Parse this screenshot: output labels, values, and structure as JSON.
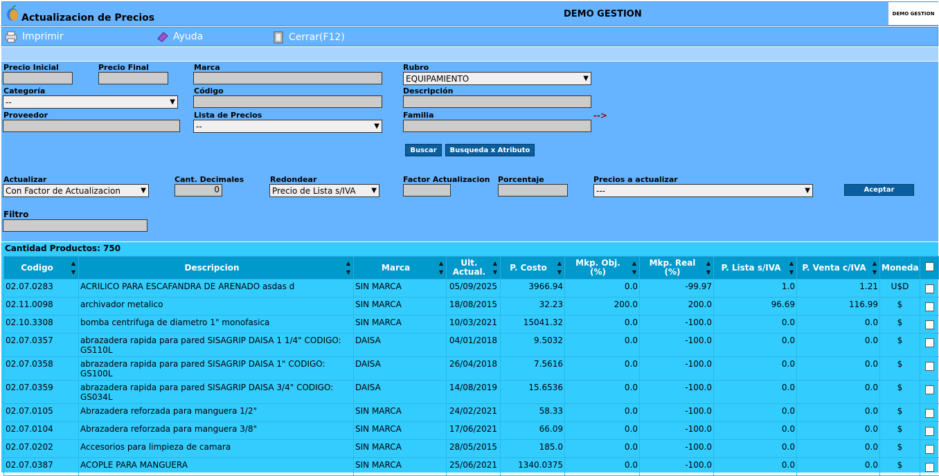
{
  "header": {
    "title": "Actualizacion de Precios",
    "company": "DEMO GESTION",
    "logo_text": "DEMO GESTION"
  },
  "toolbar": {
    "print": "Imprimir",
    "help": "Ayuda",
    "close": "Cerrar(F12)"
  },
  "filters": {
    "precio_inicial_label": "Precio Inicial",
    "precio_inicial": "",
    "precio_final_label": "Precio Final",
    "precio_final": "",
    "marca_label": "Marca",
    "marca": "",
    "rubro_label": "Rubro",
    "rubro": "EQUIPAMIENTO",
    "categoria_label": "Categoría",
    "categoria": "--",
    "codigo_label": "Código",
    "codigo": "",
    "descripcion_label": "Descripción",
    "descripcion": "",
    "proveedor_label": "Proveedor",
    "proveedor": "",
    "lista_label": "Lista de Precios",
    "lista": "--",
    "familia_label": "Familia",
    "familia": "",
    "familia_arrow": "-->",
    "buscar": "Buscar",
    "busqueda_atributo": "Busqueda x Atributo"
  },
  "update": {
    "actualizar_label": "Actualizar",
    "actualizar": "Con Factor de Actualizacion",
    "decimales_label": "Cant. Decimales",
    "decimales": "0",
    "redondear_label": "Redondear",
    "redondear": "Precio de Lista s/IVA",
    "factor_label": "Factor Actualizacion",
    "factor": "",
    "porcentaje_label": "Porcentaje",
    "porcentaje": "",
    "precios_label": "Precios a actualizar",
    "precios": "---",
    "aceptar": "Aceptar",
    "filtro_label": "Filtro",
    "filtro": ""
  },
  "table": {
    "count_label": "Cantidad Productos: 750",
    "columns": [
      "Codigo",
      "Descripcion",
      "Marca",
      "Ult. Actual.",
      "P. Costo",
      "Mkp. Obj. (%)",
      "Mkp. Real (%)",
      "P. Lista s/IVA",
      "P. Venta c/IVA",
      "Moneda"
    ],
    "rows": [
      [
        "02.07.0283",
        "ACRILICO PARA ESCAFANDRA DE ARENADO asdas d",
        "SIN MARCA",
        "05/09/2025",
        "3966.94",
        "0.0",
        "-99.97",
        "1.0",
        "1.21",
        "U$D"
      ],
      [
        "02.11.0098",
        "archivador metalico",
        "SIN MARCA",
        "18/08/2015",
        "32.23",
        "200.0",
        "200.0",
        "96.69",
        "116.99",
        "$"
      ],
      [
        "02.10.3308",
        "bomba centrifuga de diametro 1\" monofasica",
        "SIN MARCA",
        "10/03/2021",
        "15041.32",
        "0.0",
        "-100.0",
        "0.0",
        "0.0",
        "$"
      ],
      [
        "02.07.0357",
        "abrazadera rapida para pared SISAGRIP DAISA 1 1/4\" CODIGO: GS110L",
        "DAISA",
        "04/01/2018",
        "9.5032",
        "0.0",
        "-100.0",
        "0.0",
        "0.0",
        "$"
      ],
      [
        "02.07.0358",
        "abrazadera rapida para pared SISAGRIP DAISA 1\" CODIGO: GS100L",
        "DAISA",
        "26/04/2018",
        "7.5616",
        "0.0",
        "-100.0",
        "0.0",
        "0.0",
        "$"
      ],
      [
        "02.07.0359",
        "abrazadera rapida para pared SISAGRIP DAISA 3/4\" CODIGO: GS034L",
        "DAISA",
        "14/08/2019",
        "15.6536",
        "0.0",
        "-100.0",
        "0.0",
        "0.0",
        "$"
      ],
      [
        "02.07.0105",
        "Abrazadera reforzada para manguera 1/2\"",
        "SIN MARCA",
        "24/02/2021",
        "58.33",
        "0.0",
        "-100.0",
        "0.0",
        "0.0",
        "$"
      ],
      [
        "02.07.0104",
        "Abrazadera reforzada para manguera 3/8\"",
        "SIN MARCA",
        "17/06/2021",
        "66.09",
        "0.0",
        "-100.0",
        "0.0",
        "0.0",
        "$"
      ],
      [
        "02.07.0202",
        "Accesorios para limpieza de camara",
        "SIN MARCA",
        "28/05/2015",
        "185.0",
        "0.0",
        "-100.0",
        "0.0",
        "0.0",
        "$"
      ],
      [
        "02.07.0387",
        "ACOPLE PARA MANGUERA",
        "SIN MARCA",
        "25/06/2021",
        "1340.0375",
        "0.0",
        "-100.0",
        "0.0",
        "0.0",
        "$"
      ]
    ]
  }
}
